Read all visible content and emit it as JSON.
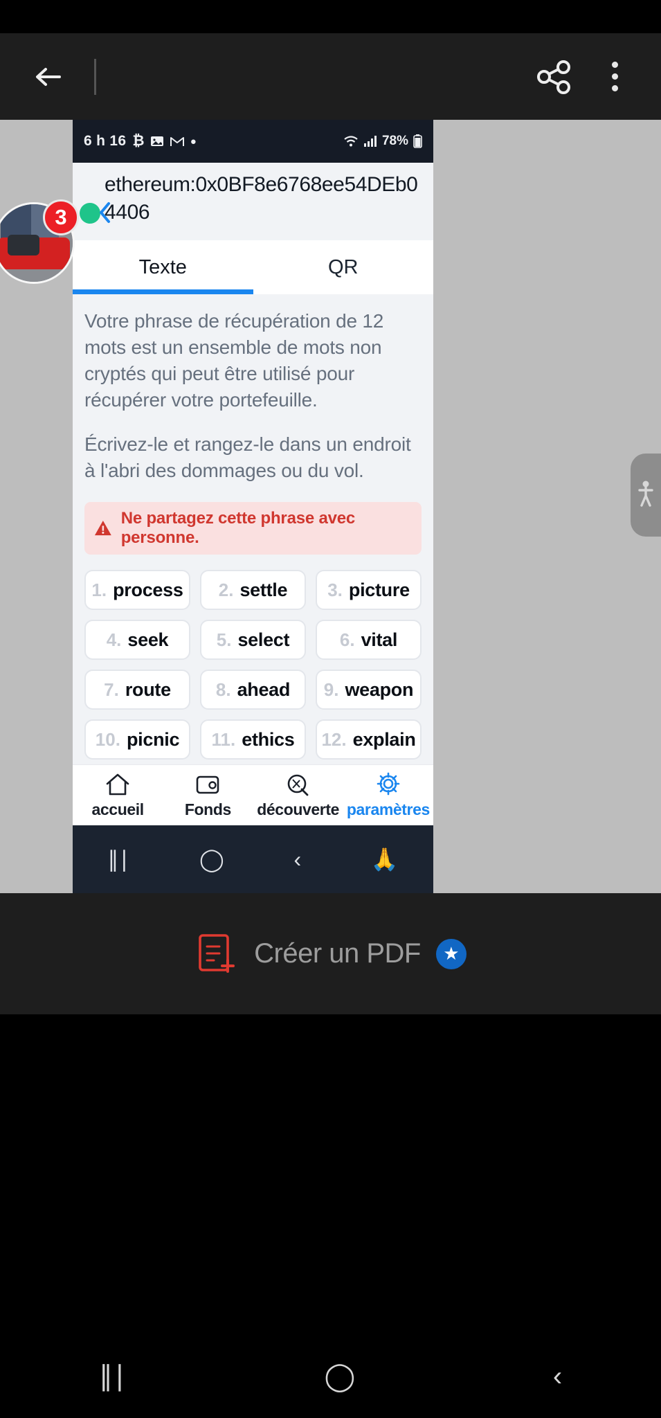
{
  "app_toolbar": {
    "back_icon": "arrow-left-icon",
    "share_icon": "share-icon",
    "more_icon": "more-vertical-icon"
  },
  "statusbar": {
    "time": "6 h 16",
    "icons": [
      "bitcoin-icon",
      "image-icon",
      "gmail-icon",
      "dot-icon"
    ],
    "right_icons": [
      "wifi-icon",
      "signal-icon"
    ],
    "battery": "78%"
  },
  "address": {
    "text": "ethereum:0x0BF8e6768ee54DEb04406",
    "status_dot": "green-status-dot",
    "back_chevron": "chevron-left-icon"
  },
  "tabs": [
    {
      "label": "Texte",
      "active": true
    },
    {
      "label": "QR",
      "active": false
    }
  ],
  "body": {
    "paragraph1": "Votre phrase de récupération de 12 mots est un ensemble de mots non cryptés qui peut être utilisé pour récupérer votre portefeuille.",
    "paragraph2": "Écrivez-le et rangez-le dans un endroit à l'abri des dommages ou du vol.",
    "warning": {
      "icon": "warning-triangle-icon",
      "text": "Ne partagez cette phrase avec personne."
    }
  },
  "seed_words": [
    {
      "num": "1.",
      "word": "process"
    },
    {
      "num": "2.",
      "word": "settle"
    },
    {
      "num": "3.",
      "word": "picture"
    },
    {
      "num": "4.",
      "word": "seek"
    },
    {
      "num": "5.",
      "word": "select"
    },
    {
      "num": "6.",
      "word": "vital"
    },
    {
      "num": "7.",
      "word": "route"
    },
    {
      "num": "8.",
      "word": "ahead"
    },
    {
      "num": "9.",
      "word": "weapon"
    },
    {
      "num": "10.",
      "word": "picnic"
    },
    {
      "num": "11.",
      "word": "ethics"
    },
    {
      "num": "12.",
      "word": "explain"
    }
  ],
  "phone_nav": [
    {
      "label": "accueil",
      "icon": "home-icon",
      "active": false
    },
    {
      "label": "Fonds",
      "icon": "wallet-icon",
      "active": false
    },
    {
      "label": "découverte",
      "icon": "compass-icon",
      "active": false
    },
    {
      "label": "paramètres",
      "icon": "gear-icon",
      "active": true
    }
  ],
  "phone_sys_nav": [
    "recents-icon",
    "home-circle-icon",
    "back-icon",
    "accessibility-icon"
  ],
  "avatar": {
    "badge_count": "3",
    "name": "motorcycle-thumbnail"
  },
  "side_pill": {
    "icon": "accessibility-icon"
  },
  "pdf_bar": {
    "icon": "pdf-add-icon",
    "label": "Créer un PDF",
    "star_icon": "star-badge-icon"
  },
  "sys_bottom": [
    "recents-icon",
    "home-circle-icon",
    "back-icon"
  ],
  "colors": {
    "accent_blue": "#1a86ef",
    "warning_red": "#d0372f",
    "status_green": "#1fc48a",
    "badge_red": "#ec1f26"
  }
}
